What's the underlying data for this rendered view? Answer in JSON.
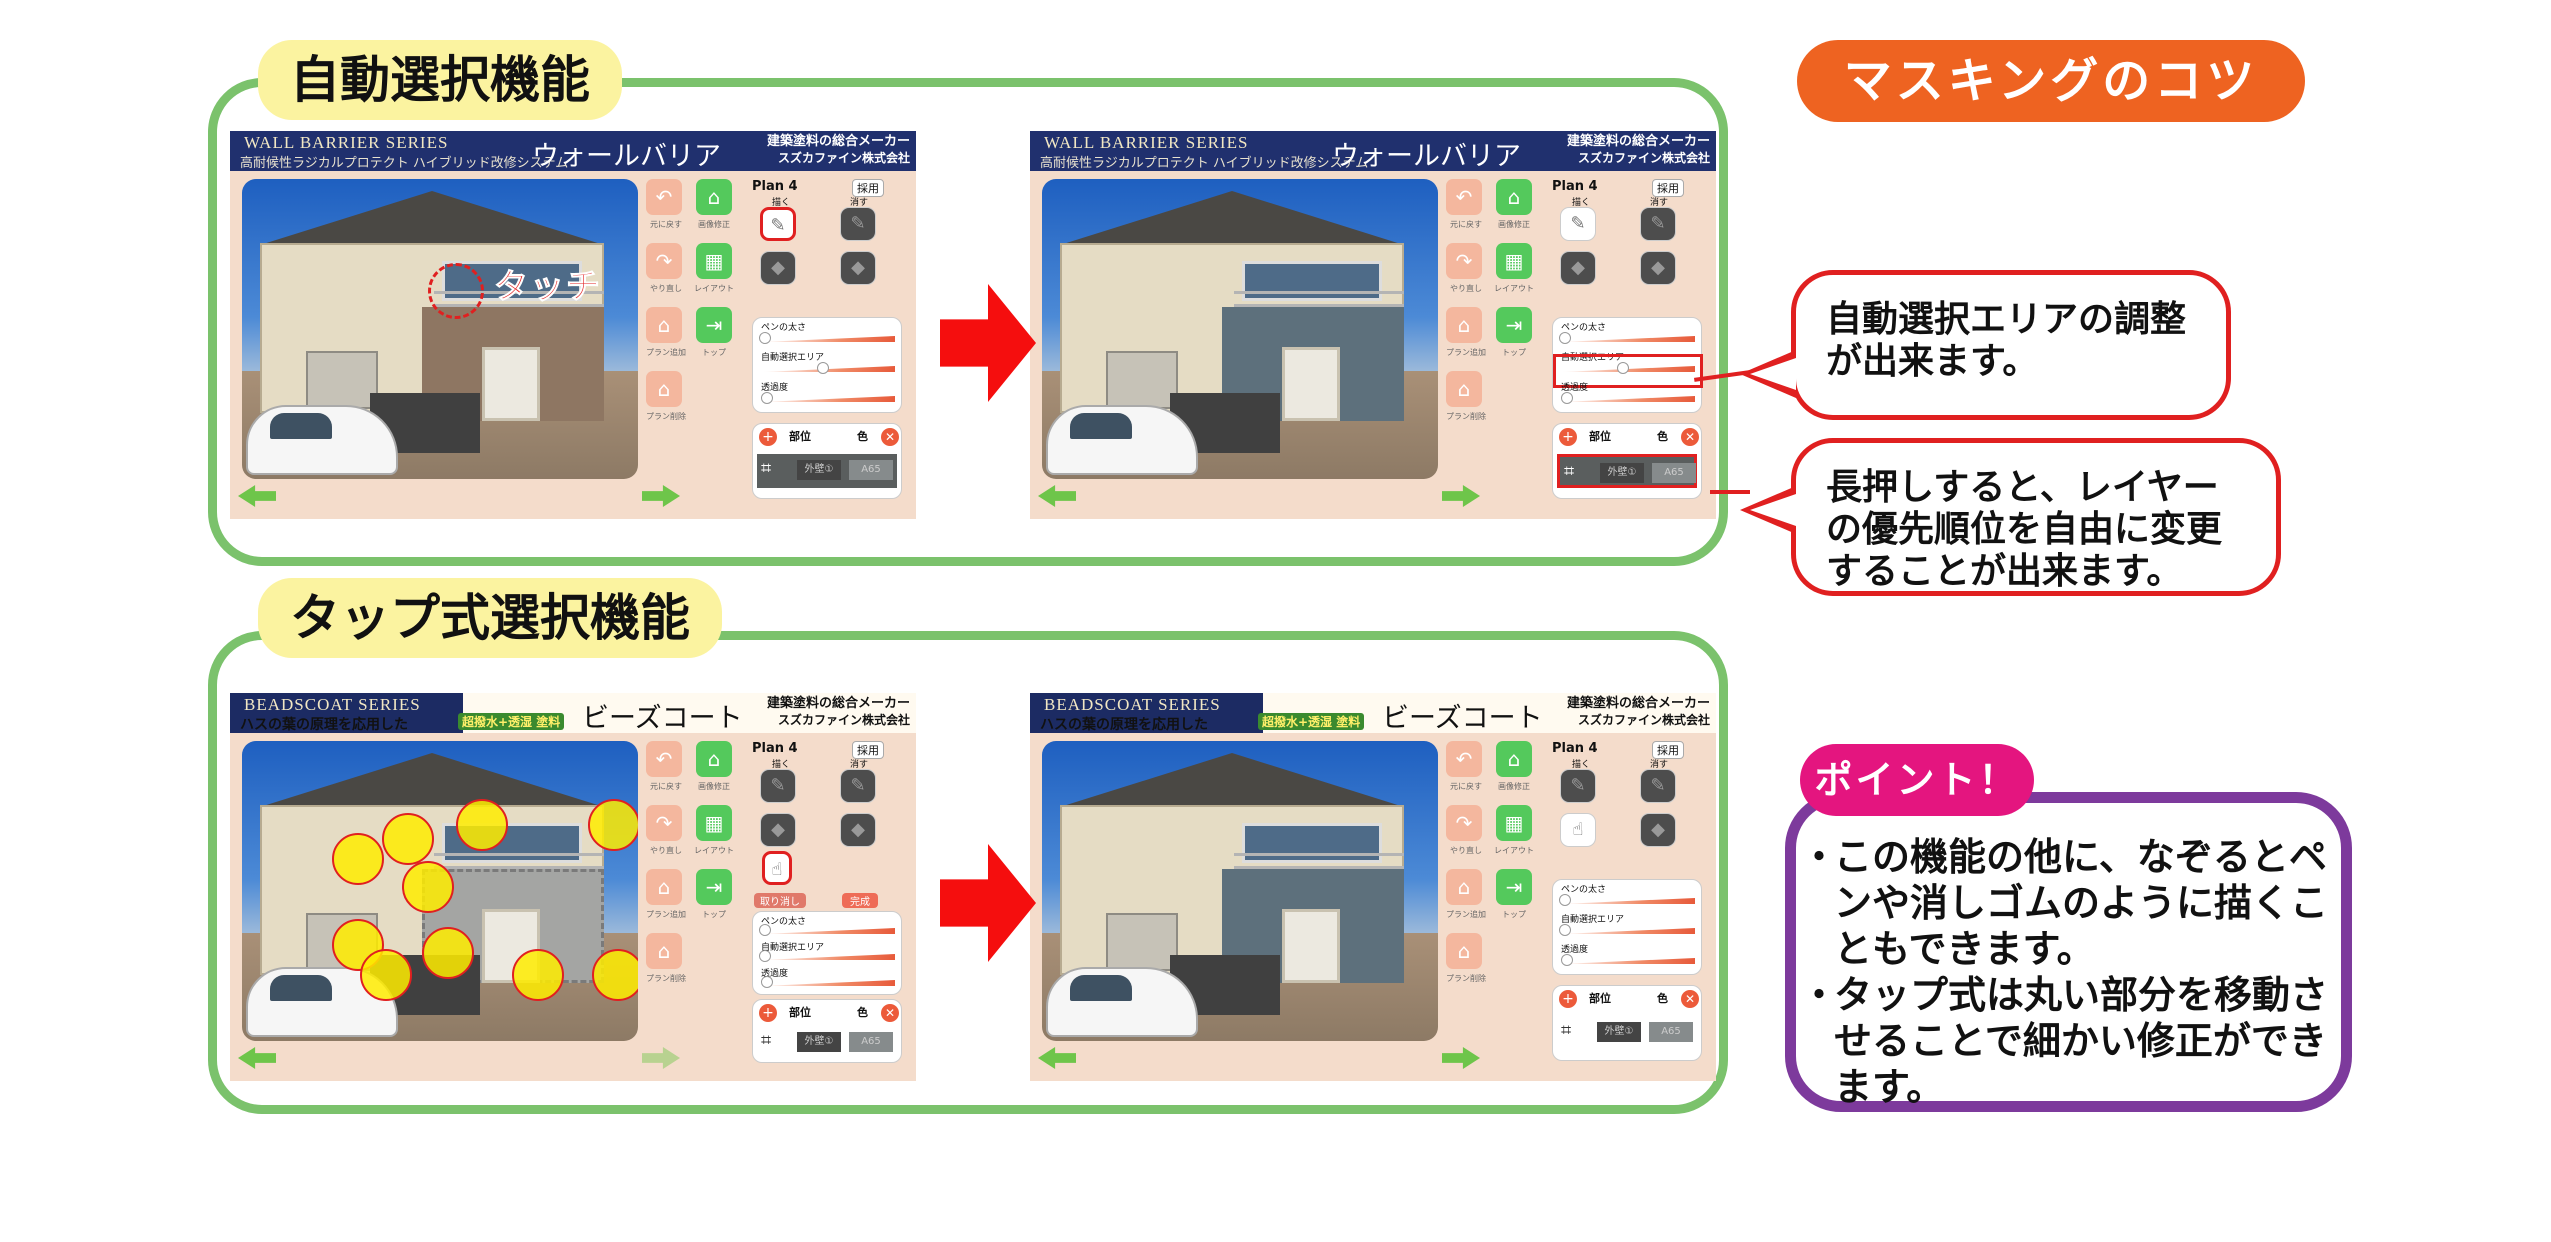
{
  "sections": {
    "auto_title": "自動選択機能",
    "tap_title": "タップ式選択機能"
  },
  "tips_title": "マスキングのコツ",
  "callouts": {
    "auto_area": "自動選択エリアの調整が出来ます。",
    "layer_priority": "長押しすると、レイヤーの優先順位を自由に変更することが出来ます。"
  },
  "point": {
    "tag": "ポイント！",
    "items": [
      "この機能の他に、なぞるとペンや消しゴムのように描くこともできます。",
      "タップ式は丸い部分を移動させることで細かい修正ができます。"
    ]
  },
  "annotation": {
    "touch": "タッチ"
  },
  "app": {
    "wall_barrier": {
      "series": "WALL BARRIER SERIES",
      "subtitle": "高耐候性ラジカルプロテクト ハイブリッド改修システム",
      "product": "ウォールバリア",
      "maker": "建築塗料の総合メーカー",
      "company": "スズカファイン株式会社"
    },
    "beadscoat": {
      "series": "BEADSCOAT SERIES",
      "subtitle": "ハスの葉の原理を応用した",
      "badge": "超撥水+透湿 塗料",
      "product": "ビーズコート",
      "maker": "建築塗料の総合メーカー",
      "company": "スズカファイン株式会社"
    },
    "left_buttons": {
      "undo": "元に戻す",
      "image_fix": "画像修正",
      "redo": "やり直し",
      "layout": "レイアウト",
      "plan_add": "プラン追加",
      "top": "トップ",
      "plan_delete": "プラン削除"
    },
    "plan": "Plan 4",
    "adopt": "採用",
    "draw": "描く",
    "erase": "消す",
    "cancel": "取り消し",
    "done": "完成",
    "pen_size": "ペンの太さ",
    "auto_select_area": "自動選択エリア",
    "opacity": "透過度",
    "part": "部位",
    "color": "色",
    "layer_icon": "⌗",
    "layer_a": "外壁①",
    "layer_b": "A65"
  },
  "colors": {
    "frame_green": "#7bc26c",
    "title_yellow": "#fbf3a0",
    "orange": "#ee6321",
    "red": "#e02020",
    "magenta": "#e4157f",
    "purple": "#7d3a9c",
    "arrow_red": "#f50e0e"
  }
}
